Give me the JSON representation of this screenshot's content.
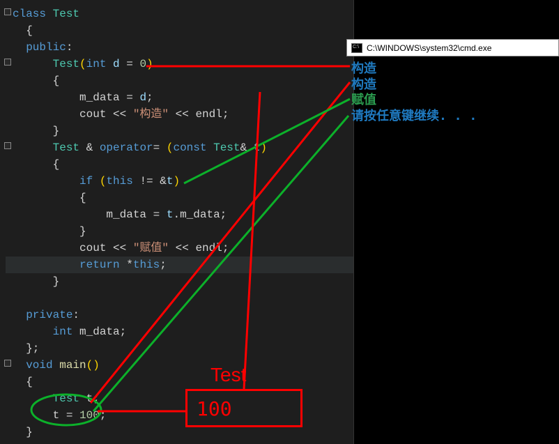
{
  "code": {
    "l1_class": "class",
    "l1_name": " Test",
    "l2_brace": "  {",
    "l3_public": "  public",
    "l3_colon": ":",
    "l4_indent": "      ",
    "l4_ctor": "Test",
    "l4_open": "(",
    "l4_int": "int",
    "l4_sp": " ",
    "l4_param": "d",
    "l4_eq": " = ",
    "l4_zero": "0",
    "l4_close": ")",
    "l5_brace": "      {",
    "l6_indent": "          ",
    "l6_member": "m_data",
    "l6_eq": " = ",
    "l6_d": "d",
    "l6_semi": ";",
    "l7_indent": "          ",
    "l7_cout": "cout",
    "l7_op": " << ",
    "l7_str": "\"构造\"",
    "l7_op2": " << ",
    "l7_endl": "endl",
    "l7_semi": ";",
    "l8_brace": "      }",
    "l9_indent": "      ",
    "l9_test": "Test",
    "l9_amp": " &",
    "l9_sp": " ",
    "l9_opname": "operator",
    "l9_eq": "=",
    "l9_sp2": " ",
    "l9_open": "(",
    "l9_const": "const",
    "l9_sp3": " ",
    "l9_test2": "Test",
    "l9_amp2": "&",
    "l9_sp4": " ",
    "l9_t": "t",
    "l9_close": ")",
    "l10_brace": "      {",
    "l11_indent": "          ",
    "l11_if": "if",
    "l11_sp": " ",
    "l11_open": "(",
    "l11_this": "this",
    "l11_ne": " != ",
    "l11_amp": "&",
    "l11_t": "t",
    "l11_close": ")",
    "l12_brace": "          {",
    "l13_indent": "              ",
    "l13_member": "m_data",
    "l13_eq": " = ",
    "l13_t": "t",
    "l13_dot": ".",
    "l13_member2": "m_data",
    "l13_semi": ";",
    "l14_brace": "          }",
    "l15_indent": "          ",
    "l15_cout": "cout",
    "l15_op": " << ",
    "l15_str": "\"赋值\"",
    "l15_op2": " << ",
    "l15_endl": "endl",
    "l15_semi": ";",
    "l16_indent": "          ",
    "l16_return": "return",
    "l16_sp": " ",
    "l16_star": "*",
    "l16_this": "this",
    "l16_semi": ";",
    "l17_brace": "      }",
    "l18_blank": "",
    "l19_private": "  private",
    "l19_colon": ":",
    "l20_indent": "      ",
    "l20_int": "int",
    "l20_sp": " ",
    "l20_member": "m_data",
    "l20_semi": ";",
    "l21_brace": "  };",
    "l22_void": "  void",
    "l22_sp": " ",
    "l22_main": "main",
    "l22_parens": "()",
    "l23_brace": "  {",
    "l24_indent": "      ",
    "l24_test": "Test",
    "l24_sp": " ",
    "l24_t": "t",
    "l24_semi": ";",
    "l25_indent": "      ",
    "l25_t": "t",
    "l25_eq": " = ",
    "l25_num": "100",
    "l25_semi": ";",
    "l26_brace": "  }"
  },
  "cmd": {
    "title": "C:\\WINDOWS\\system32\\cmd.exe",
    "out1": "构造",
    "out2": "构造",
    "out3": "赋值",
    "out4": "请按任意键继续. . ."
  },
  "annotation": {
    "label": "Test",
    "value": "100"
  }
}
